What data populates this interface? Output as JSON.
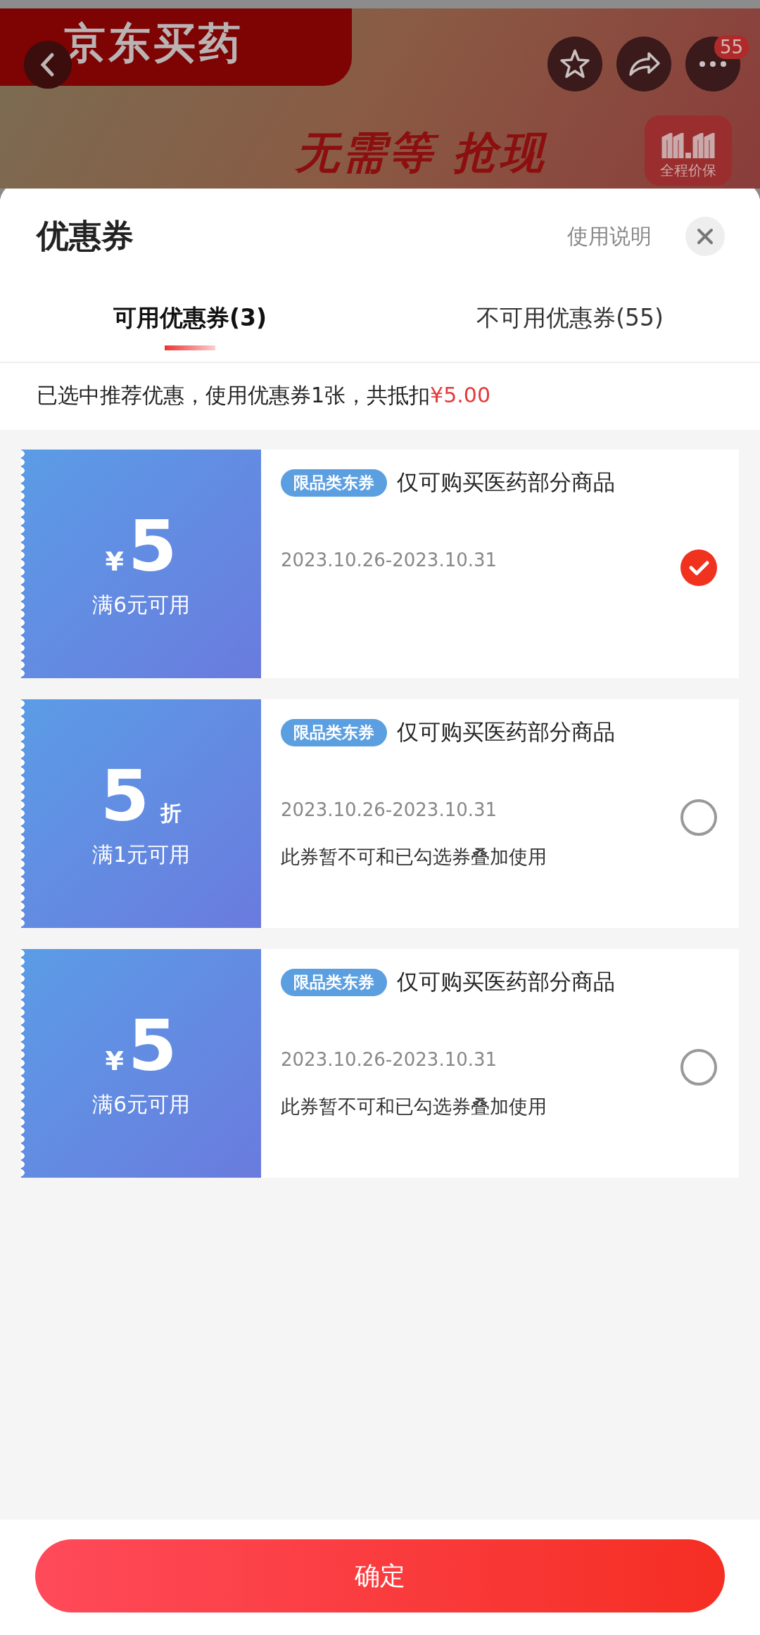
{
  "banner": {
    "brand": "京东买药",
    "badge": "55",
    "slogan": "无需等 抢现",
    "promo_label": "全程价保"
  },
  "sheet": {
    "title": "优惠券",
    "help_link": "使用说明",
    "tabs": [
      {
        "label": "可用优惠券(3)",
        "selected": true
      },
      {
        "label": "不可用优惠券(55)",
        "selected": false
      }
    ],
    "summary": "已选中推荐优惠，使用优惠券1张，共抵扣",
    "summary_amount": "¥5.00",
    "coupons": [
      {
        "kind": "amount",
        "symbol": "¥",
        "value": "5",
        "condition": "满6元可用",
        "tag": "限品类东券",
        "title": "仅可购买医药部分商品",
        "date": "2023.10.26-2023.10.31",
        "selected": true
      },
      {
        "kind": "discount",
        "symbol": "折",
        "value": "5",
        "condition": "满1元可用",
        "tag": "限品类东券",
        "title": "仅可购买医药部分商品",
        "date": "2023.10.26-2023.10.31",
        "note": "此券暂不可和已勾选券叠加使用",
        "selected": false
      },
      {
        "kind": "amount",
        "symbol": "¥",
        "value": "5",
        "condition": "满6元可用",
        "tag": "限品类东券",
        "title": "仅可购买医药部分商品",
        "date": "2023.10.26-2023.10.31",
        "note": "此券暂不可和已勾选券叠加使用",
        "selected": false
      }
    ],
    "confirm_button": "确定"
  }
}
